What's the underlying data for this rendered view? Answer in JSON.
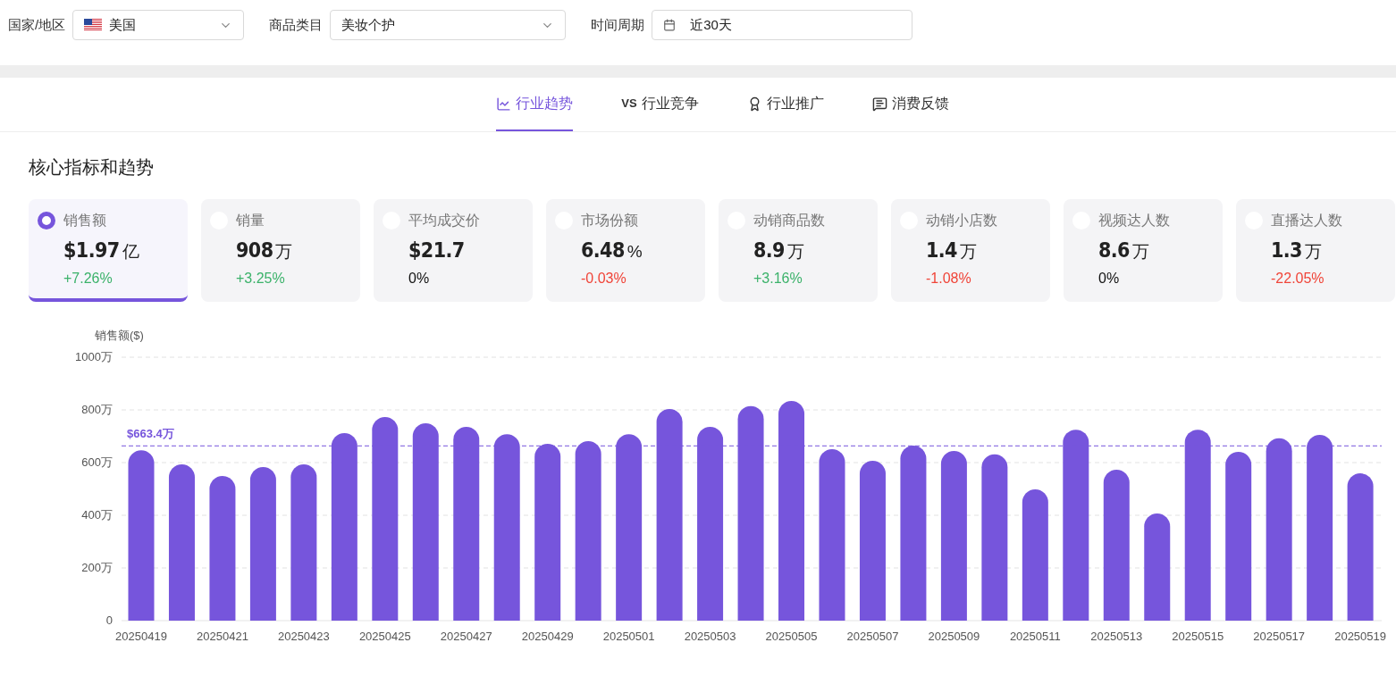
{
  "filters": [
    {
      "label": "国家/地区",
      "value": "美国",
      "kind": "flag"
    },
    {
      "label": "商品类目",
      "value": "美妆个护",
      "kind": "select"
    },
    {
      "label": "时间周期",
      "value": "近30天",
      "kind": "date"
    }
  ],
  "tabs": [
    {
      "label": "行业趋势",
      "selected": true
    },
    {
      "label": "行业竞争",
      "icon_text": "VS",
      "selected": false
    },
    {
      "label": "行业推广",
      "selected": false
    },
    {
      "label": "消费反馈",
      "selected": false
    }
  ],
  "section_title": "核心指标和趋势",
  "metrics": [
    {
      "label": "销售额",
      "value": "$1.97",
      "unit": "亿",
      "change": "+7.26%",
      "color": "#3bb26a",
      "selected": true
    },
    {
      "label": "销量",
      "value": "908",
      "unit": "万",
      "change": "+3.25%",
      "color": "#3bb26a",
      "selected": false
    },
    {
      "label": "平均成交价",
      "value": "$21.7",
      "change": "0%",
      "color": "#111111",
      "selected": false
    },
    {
      "label": "市场份额",
      "value": "6.48",
      "unit": "%",
      "change": "-0.03%",
      "color": "#f04438",
      "selected": false
    },
    {
      "label": "动销商品数",
      "value": "8.9",
      "unit": "万",
      "change": "+3.16%",
      "color": "#3bb26a",
      "selected": false
    },
    {
      "label": "动销小店数",
      "value": "1.4",
      "unit": "万",
      "change": "-1.08%",
      "color": "#f04438",
      "selected": false
    },
    {
      "label": "视频达人数",
      "value": "8.6",
      "unit": "万",
      "change": "0%",
      "color": "#111111",
      "selected": false
    },
    {
      "label": "直播达人数",
      "value": "1.3",
      "unit": "万",
      "change": "-22.05%",
      "color": "#f04438",
      "selected": false
    }
  ],
  "chart": {
    "chart_data": {
      "type": "bar",
      "ylabel": "销售额($)",
      "categories": [
        "20250419",
        null,
        "20250421",
        null,
        "20250423",
        null,
        "20250425",
        null,
        "20250427",
        null,
        "20250429",
        null,
        "20250501",
        null,
        "20250503",
        null,
        "20250505",
        null,
        "20250507",
        null,
        "20250509",
        null,
        "20250511",
        null,
        "20250513",
        null,
        "20250515",
        null,
        "20250517",
        null,
        "20250519"
      ],
      "series": [
        {
          "color": "#7655dc",
          "values": [
            647,
            593,
            549,
            583,
            593,
            712,
            773,
            749,
            736,
            708,
            671,
            681,
            708,
            803,
            736,
            814,
            834,
            651,
            607,
            664,
            644,
            631,
            498,
            725,
            573,
            407,
            725,
            641,
            692,
            705,
            559
          ]
        }
      ],
      "ylim": [
        0,
        1000
      ],
      "yticks": [
        {
          "value": 0,
          "label": "0"
        },
        {
          "value": 200,
          "label": "200万"
        },
        {
          "value": 400,
          "label": "400万"
        },
        {
          "value": 600,
          "label": "600万"
        },
        {
          "value": 800,
          "label": "800万"
        },
        {
          "value": 1000,
          "label": "1000万"
        }
      ],
      "grid": true,
      "ref_lines": [
        {
          "axis": "y",
          "value": 663.4,
          "label": "$663.4万"
        }
      ]
    }
  }
}
